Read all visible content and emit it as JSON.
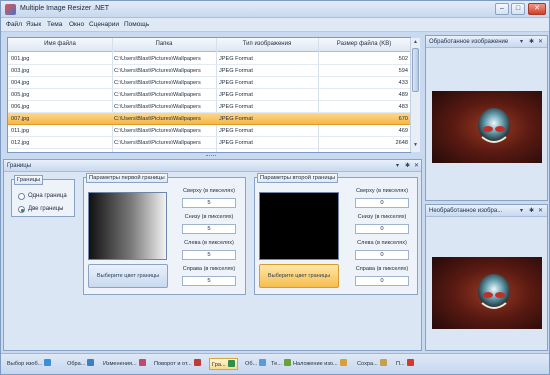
{
  "window": {
    "title": "Multiple Image Resizer .NET",
    "minimize": "–",
    "maximize": "□",
    "close": "✕"
  },
  "menu": [
    "Файл",
    "Язык",
    "Тема",
    "Окно",
    "Сценарии",
    "Помощь"
  ],
  "grid": {
    "headers": [
      "Имя файла",
      "Папка",
      "Тип изображения",
      "Размер файла (KB)"
    ],
    "rows": [
      {
        "name": "001.jpg",
        "folder": "C:\\Users\\Blast\\Pictures\\Wallpapers",
        "type": "JPEG Format",
        "size": "502"
      },
      {
        "name": "003.jpg",
        "folder": "C:\\Users\\Blast\\Pictures\\Wallpapers",
        "type": "JPEG Format",
        "size": "594"
      },
      {
        "name": "004.jpg",
        "folder": "C:\\Users\\Blast\\Pictures\\Wallpapers",
        "type": "JPEG Format",
        "size": "433"
      },
      {
        "name": "005.jpg",
        "folder": "C:\\Users\\Blast\\Pictures\\Wallpapers",
        "type": "JPEG Format",
        "size": "489"
      },
      {
        "name": "006.jpg",
        "folder": "C:\\Users\\Blast\\Pictures\\Wallpapers",
        "type": "JPEG Format",
        "size": "483"
      },
      {
        "name": "007.jpg",
        "folder": "C:\\Users\\Blast\\Pictures\\Wallpapers",
        "type": "JPEG Format",
        "size": "670"
      },
      {
        "name": "011.jpg",
        "folder": "C:\\Users\\Blast\\Pictures\\Wallpapers",
        "type": "JPEG Format",
        "size": "469"
      },
      {
        "name": "012.jpg",
        "folder": "C:\\Users\\Blast\\Pictures\\Wallpapers",
        "type": "JPEG Format",
        "size": "2648"
      }
    ],
    "selected_row": "007.jpg"
  },
  "borders_panel": {
    "title": "Границы",
    "borders_group": {
      "caption": "Границы",
      "options": [
        "Одна граница",
        "Две границы"
      ],
      "selected": "Две границы"
    },
    "first_border": {
      "caption": "Параметры первой границы",
      "color_button": "Выберите цвет границы",
      "fields": [
        {
          "label": "Сверху (в пикселях)",
          "value": "5"
        },
        {
          "label": "Снизу (в пикселях)",
          "value": "5"
        },
        {
          "label": "Слева (в пикселях)",
          "value": "5"
        },
        {
          "label": "Справа (в пикселях)",
          "value": "5"
        }
      ]
    },
    "second_border": {
      "caption": "Параметры второй границы",
      "color_button": "Выберите цвет границы",
      "fields": [
        {
          "label": "Сверху (в пикселях)",
          "value": "0"
        },
        {
          "label": "Снизу (в пикселях)",
          "value": "0"
        },
        {
          "label": "Слева (в пикселях)",
          "value": "0"
        },
        {
          "label": "Справа (в пикселях)",
          "value": "0"
        }
      ]
    }
  },
  "processed_panel": {
    "title": "Обработанное изображение"
  },
  "unprocessed_panel": {
    "title": "Необработанное изобра..."
  },
  "panel_buttons": {
    "dropdown": "▾",
    "pin": "✱",
    "close": "✕"
  },
  "status_tabs": [
    {
      "label": "Выбор изоб...",
      "color": "#3c8fd6"
    },
    {
      "label": "Обра...",
      "color": "#3a7fc8"
    },
    {
      "label": "Изменения...",
      "color": "#c04a6a"
    },
    {
      "label": "Поворот и от...",
      "color": "#c03a3a"
    },
    {
      "label": "Гра...",
      "color": "#2f8f4a"
    },
    {
      "label": "Об...",
      "color": "#5a9ad8"
    },
    {
      "label": "Те...",
      "color": "#6aa03a"
    },
    {
      "label": "Наложение изо...",
      "color": "#d8a03a"
    },
    {
      "label": "Сохра...",
      "color": "#c8a04a"
    },
    {
      "label": "П...",
      "color": "#d23a2a"
    }
  ],
  "active_tab": "Гра..."
}
